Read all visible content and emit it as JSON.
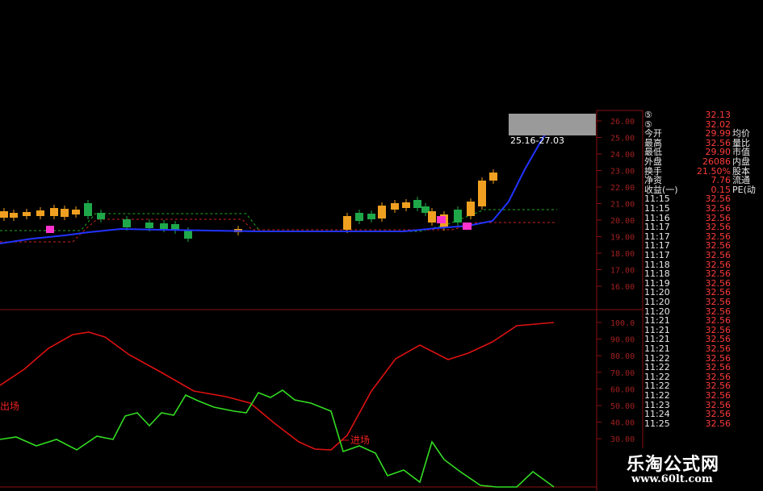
{
  "chart_data": {
    "type": "candlestick",
    "price_axis": {
      "ticks": [
        "26.00",
        "25.00",
        "24.00",
        "23.00",
        "22.00",
        "21.00",
        "20.00",
        "19.00",
        "18.00",
        "17.00",
        "16.00"
      ]
    },
    "indicator_axis": {
      "ticks": [
        "100.0",
        "90.00",
        "80.00",
        "70.00",
        "60.00",
        "50.00",
        "40.00",
        "30.00"
      ]
    },
    "range_label": "25.16-27.03",
    "labels": {
      "entry": "进场",
      "exit": "出场"
    },
    "colors": {
      "up": "#f0a020",
      "down": "#1fa84a",
      "ma": "#2233ff",
      "red_line": "#dd1111",
      "green_line": "#33dd22",
      "signal": "#ff33cc"
    }
  },
  "quote_panel": {
    "top_rows": [
      {
        "label": "⑤",
        "value": "32.13"
      },
      {
        "label": "⑤",
        "value": "32.02"
      }
    ],
    "stats": [
      {
        "label": "今开",
        "value": "29.99",
        "label2": "均价"
      },
      {
        "label": "最高",
        "value": "32.56",
        "label2": "量比"
      },
      {
        "label": "最低",
        "value": "29.90",
        "label2": "市值"
      },
      {
        "label": "外盘",
        "value": "26086",
        "label2": "内盘"
      },
      {
        "label": "换手",
        "value": "21.50%",
        "label2": "股本"
      },
      {
        "label": "净资",
        "value": "7.76",
        "label2": "流通"
      },
      {
        "label": "收益(一)",
        "value": "0.15",
        "label2": "PE(动"
      }
    ],
    "ticks": [
      {
        "time": "11:15",
        "price": "32.56"
      },
      {
        "time": "11:15",
        "price": "32.56"
      },
      {
        "time": "11:16",
        "price": "32.56"
      },
      {
        "time": "11:17",
        "price": "32.56"
      },
      {
        "time": "11:17",
        "price": "32.56"
      },
      {
        "time": "11:17",
        "price": "32.56"
      },
      {
        "time": "11:17",
        "price": "32.56"
      },
      {
        "time": "11:18",
        "price": "32.56"
      },
      {
        "time": "11:18",
        "price": "32.56"
      },
      {
        "time": "11:19",
        "price": "32.56"
      },
      {
        "time": "11:20",
        "price": "32.56"
      },
      {
        "time": "11:20",
        "price": "32.56"
      },
      {
        "time": "11:20",
        "price": "32.56"
      },
      {
        "time": "11:21",
        "price": "32.56"
      },
      {
        "time": "11:21",
        "price": "32.56"
      },
      {
        "time": "11:21",
        "price": "32.56"
      },
      {
        "time": "11:21",
        "price": "32.56"
      },
      {
        "time": "11:22",
        "price": "32.56"
      },
      {
        "time": "11:22",
        "price": "32.56"
      },
      {
        "time": "11:22",
        "price": "32.56"
      },
      {
        "time": "11:22",
        "price": "32.56"
      },
      {
        "time": "11:22",
        "price": "32.56"
      },
      {
        "time": "11:23",
        "price": "32.56"
      },
      {
        "time": "11:24",
        "price": "32.56"
      },
      {
        "time": "11:25",
        "price": "32.56"
      }
    ]
  },
  "watermark": {
    "title": "乐淘公式网",
    "url": "www.60lt.com"
  }
}
